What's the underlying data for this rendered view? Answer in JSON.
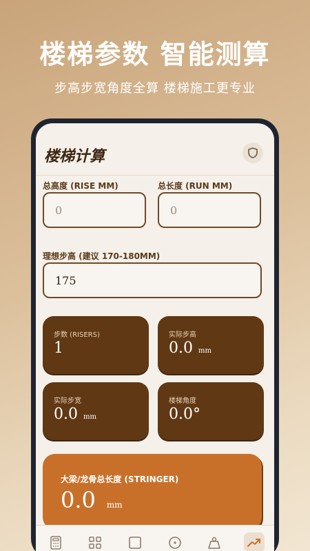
{
  "hero": {
    "title": "楼梯参数 智能测算",
    "subtitle": "步高步宽角度全算 楼梯施工更专业"
  },
  "app": {
    "title": "楼梯计算",
    "icons": {
      "header": "shield-icon"
    }
  },
  "inputs": {
    "total_height": {
      "label": "总高度 (RISE MM)",
      "value": "0"
    },
    "total_length": {
      "label": "总长度 (RUN MM)",
      "value": "0"
    },
    "ideal_step": {
      "label": "理想步高 (建议 170-180MM)",
      "value": "175"
    }
  },
  "results": {
    "risers": {
      "label": "步数 (RISERS)",
      "value": "1"
    },
    "actual_rise": {
      "label": "实际步高",
      "value": "0.0",
      "unit": "mm"
    },
    "actual_tread": {
      "label": "实际步宽",
      "value": "0.0",
      "unit": "mm"
    },
    "stair_angle": {
      "label": "楼梯角度",
      "value": "0.0°"
    },
    "stringer": {
      "label": "大梁/龙骨总长度 (STRINGER)",
      "value": "0.0",
      "unit": "mm"
    }
  },
  "tabbar": {
    "items": [
      "calculator-icon",
      "grid-icon",
      "square-icon",
      "circle-dot-icon",
      "weight-icon",
      "trending-up-icon"
    ],
    "active_index": 5
  },
  "colors": {
    "card_dark": "#603813",
    "card_orange": "#c8702a",
    "border": "#6e4a27"
  }
}
